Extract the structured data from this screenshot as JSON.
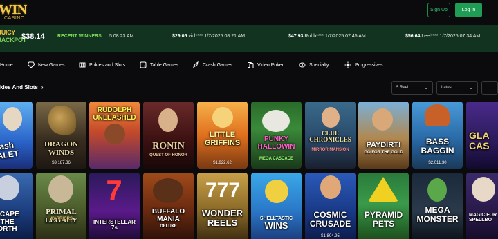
{
  "header": {
    "logo_main": "WIN",
    "logo_sub": "CASINO",
    "signup_label": "Sign Up",
    "login_label": "Log In"
  },
  "ticker": {
    "jackpot_line1": "JUICY",
    "jackpot_line2": "JACKPOT",
    "jackpot_amount": "$38.14",
    "recent_label": "RECENT WINNERS",
    "wins": [
      {
        "amount": "",
        "text": "5 08:23 AM"
      },
      {
        "amount": "$29.05",
        "text": "vicl**** 1/7/2025 08:21 AM"
      },
      {
        "amount": "$47.93",
        "text": "Robb**** 1/7/2025 07:45 AM"
      },
      {
        "amount": "$56.64",
        "text": "Leel**** 1/7/2025 07:34 AM"
      }
    ]
  },
  "nav": [
    {
      "label": "Home",
      "icon": "home-icon"
    },
    {
      "label": "New Games",
      "icon": "diamond-icon"
    },
    {
      "label": "Pokies and Slots",
      "icon": "slot-icon"
    },
    {
      "label": "Table Games",
      "icon": "dice-icon"
    },
    {
      "label": "Crash Games",
      "icon": "rocket-icon"
    },
    {
      "label": "Video Poker",
      "icon": "cards-icon"
    },
    {
      "label": "Specialty",
      "icon": "specialty-icon"
    },
    {
      "label": "Progressives",
      "icon": "progressive-icon"
    }
  ],
  "section": {
    "title": "kies And Slots",
    "filter_reel": "5 Reel",
    "sort": "Latest"
  },
  "games_row1": [
    {
      "title": "ash\nALET",
      "sub": "",
      "amount": ""
    },
    {
      "title": "DRAGON\nWINDS",
      "sub": "",
      "amount": "$3,187.36"
    },
    {
      "title": "RUDOLPH\nUNLEASHED",
      "sub": "",
      "amount": ""
    },
    {
      "title": "RONIN",
      "sub": "QUEST OF HONOR",
      "amount": ""
    },
    {
      "title": "LITTLE\nGRIFFINS",
      "sub": "",
      "amount": "$1,922.62"
    },
    {
      "title": "PUNKY\nHALLOWIN",
      "sub": "MEGA CASCADE",
      "amount": ""
    },
    {
      "title": "CLUE\nCHRONICLES",
      "sub": "MIRROR MANSION",
      "amount": ""
    },
    {
      "title": "PAYDIRT!",
      "sub": "GO FOR THE GOLD",
      "amount": ""
    },
    {
      "title": "BASS\nBAGGIN",
      "sub": "",
      "amount": "$2,011.30"
    },
    {
      "title": "GLA\nCAS",
      "sub": "",
      "amount": ""
    }
  ],
  "games_row2": [
    {
      "title": "SCAPE\nTHE\nORTH",
      "sub": "",
      "amount": ""
    },
    {
      "title": "PRIMAL\nLEGACY",
      "sub": "WARRIORS",
      "amount": ""
    },
    {
      "title": "INTERSTELLAR\n7s",
      "sub": "",
      "amount": ""
    },
    {
      "title": "BUFFALO\nMANIA",
      "sub": "DELUXE",
      "amount": ""
    },
    {
      "title": "WONDER\nREELS",
      "sub": "",
      "amount": ""
    },
    {
      "title": "WINS",
      "sub": "SHELLTASTIC",
      "amount": ""
    },
    {
      "title": "COSMIC\nCRUSADE",
      "sub": "",
      "amount": "$1,804.95"
    },
    {
      "title": "PYRAMID\nPETS",
      "sub": "",
      "amount": ""
    },
    {
      "title": "MEGA\nMONSTER",
      "sub": "",
      "amount": ""
    },
    {
      "title": "",
      "sub": "MAGIC FOR\nSPELLBO",
      "amount": ""
    }
  ],
  "colors": {
    "accent_green": "#1f9d55",
    "ticker_bg": "#12331f",
    "gold": "#f2c94c"
  }
}
